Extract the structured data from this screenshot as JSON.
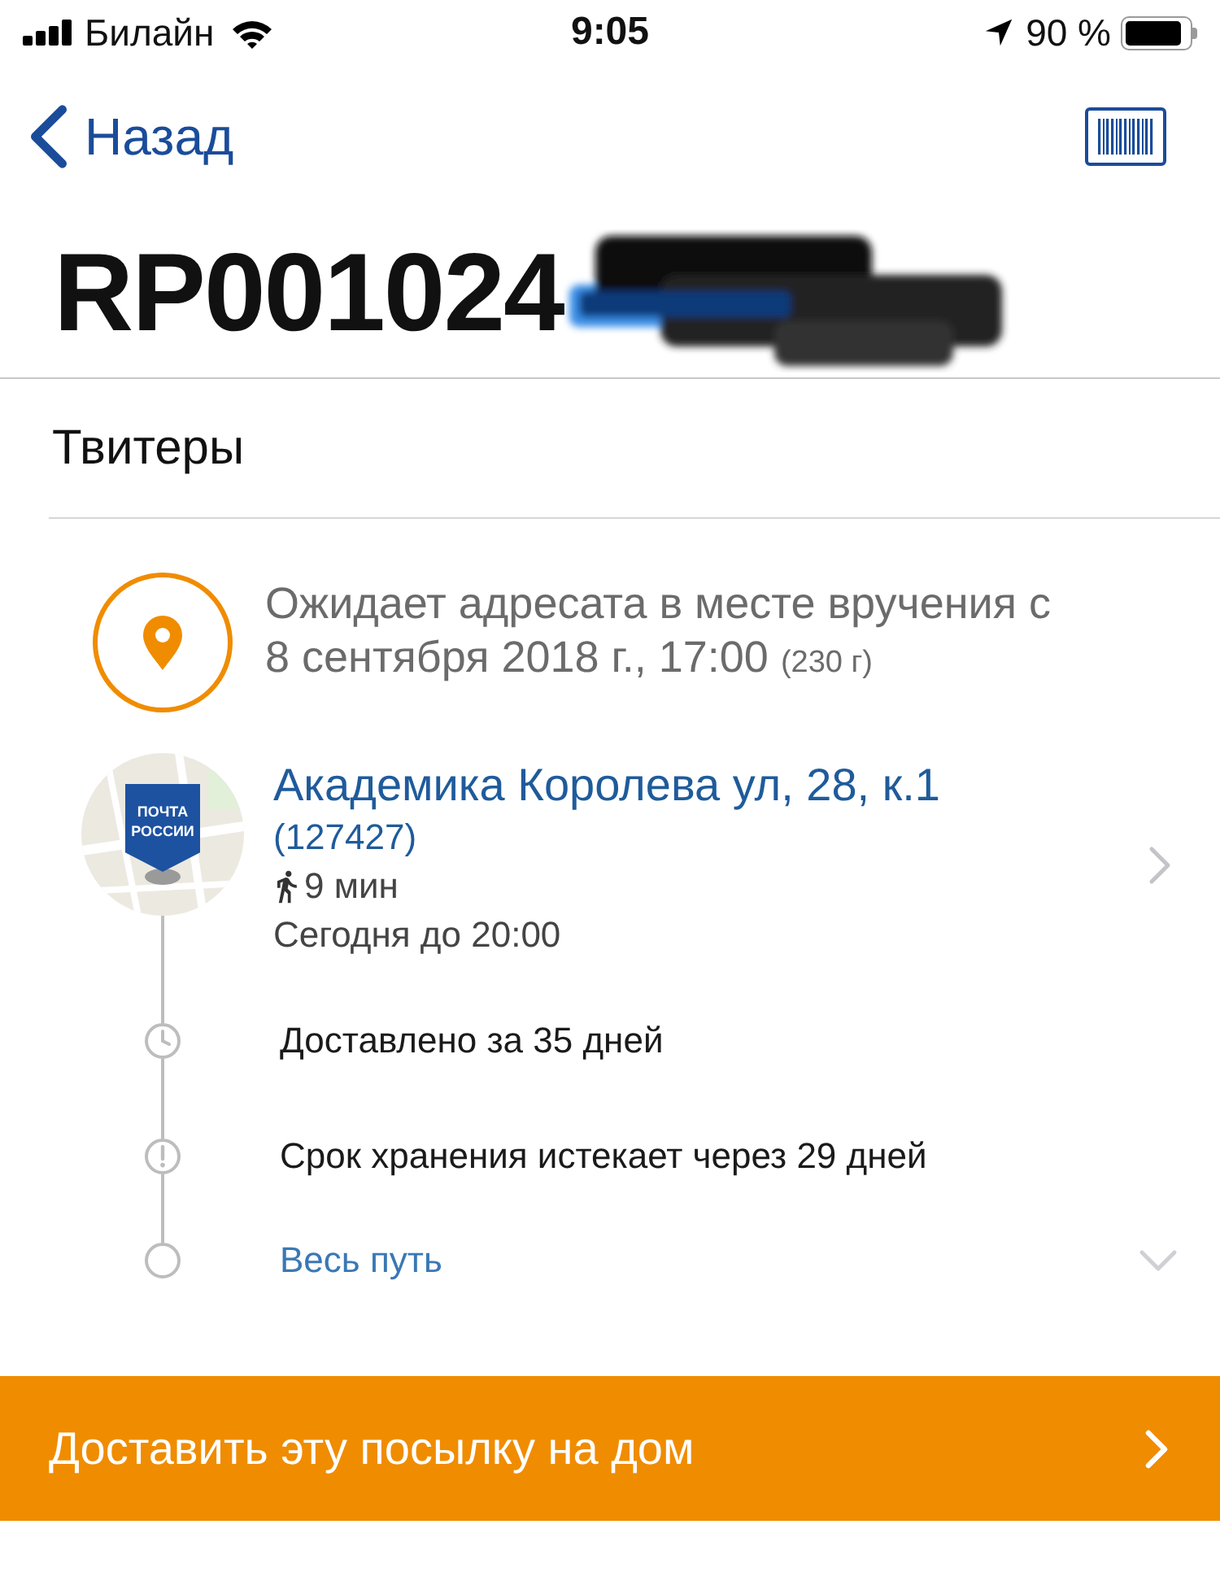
{
  "status_bar": {
    "carrier": "Билайн",
    "time": "9:05",
    "battery": "90 %"
  },
  "nav": {
    "back": "Назад"
  },
  "tracking_number": "RP001024",
  "item_name": "Твитеры",
  "status": {
    "lines": [
      "Ожидает адресата в месте вручения с",
      "8 сентября 2018 г., 17:00"
    ],
    "weight": "(230 г)"
  },
  "office": {
    "logo_lines": [
      "ПОЧТА",
      "РОССИИ"
    ],
    "address": "Академика Королева ул, 28, к.1",
    "postcode": "(127427)",
    "walk_time": "9 мин",
    "hours": "Сегодня до 20:00"
  },
  "timeline": [
    {
      "kind": "clock",
      "text": "Доставлено за 35 дней"
    },
    {
      "kind": "alert",
      "text": "Срок хранения истекает через 29 дней"
    },
    {
      "kind": "link",
      "text": "Весь путь",
      "expanded": false
    }
  ],
  "action_button": {
    "label": "Доставить эту посылку на дом"
  }
}
